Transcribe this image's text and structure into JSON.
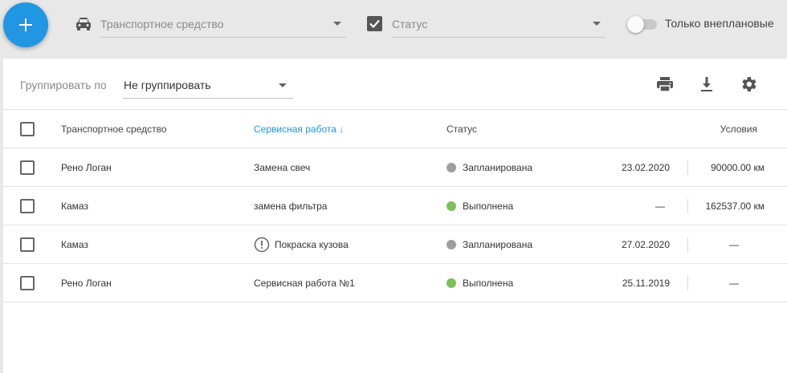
{
  "topbar": {
    "add_button": "+",
    "vehicle_filter_placeholder": "Транспортное средство",
    "status_filter_placeholder": "Статус",
    "only_unplanned_label": "Только внеплановые"
  },
  "toolbar": {
    "group_by_label": "Группировать по",
    "group_by_value": "Не группировать"
  },
  "table": {
    "headers": {
      "vehicle": "Транспортное средство",
      "service": "Сервисная работа ↓",
      "status": "Статус",
      "conditions": "Условия"
    },
    "rows": [
      {
        "vehicle": "Рено Логан",
        "service": "Замена свеч",
        "status": "Запланирована",
        "status_color": "#9e9e9e",
        "date": "23.02.2020",
        "condition": "90000.00 км",
        "warning": false
      },
      {
        "vehicle": "Камаз",
        "service": "замена фильтра",
        "status": "Выполнена",
        "status_color": "#7cc05a",
        "date": "—",
        "condition": "162537.00 км",
        "warning": false
      },
      {
        "vehicle": "Камаз",
        "service": "Покраска кузова",
        "status": "Запланирована",
        "status_color": "#9e9e9e",
        "date": "27.02.2020",
        "condition": "—",
        "warning": true
      },
      {
        "vehicle": "Рено Логан",
        "service": "Сервисная работа №1",
        "status": "Выполнена",
        "status_color": "#7cc05a",
        "date": "25.11.2019",
        "condition": "—",
        "warning": false
      }
    ]
  },
  "colors": {
    "accent": "#2196e3",
    "planned": "#9e9e9e",
    "done": "#7cc05a"
  }
}
